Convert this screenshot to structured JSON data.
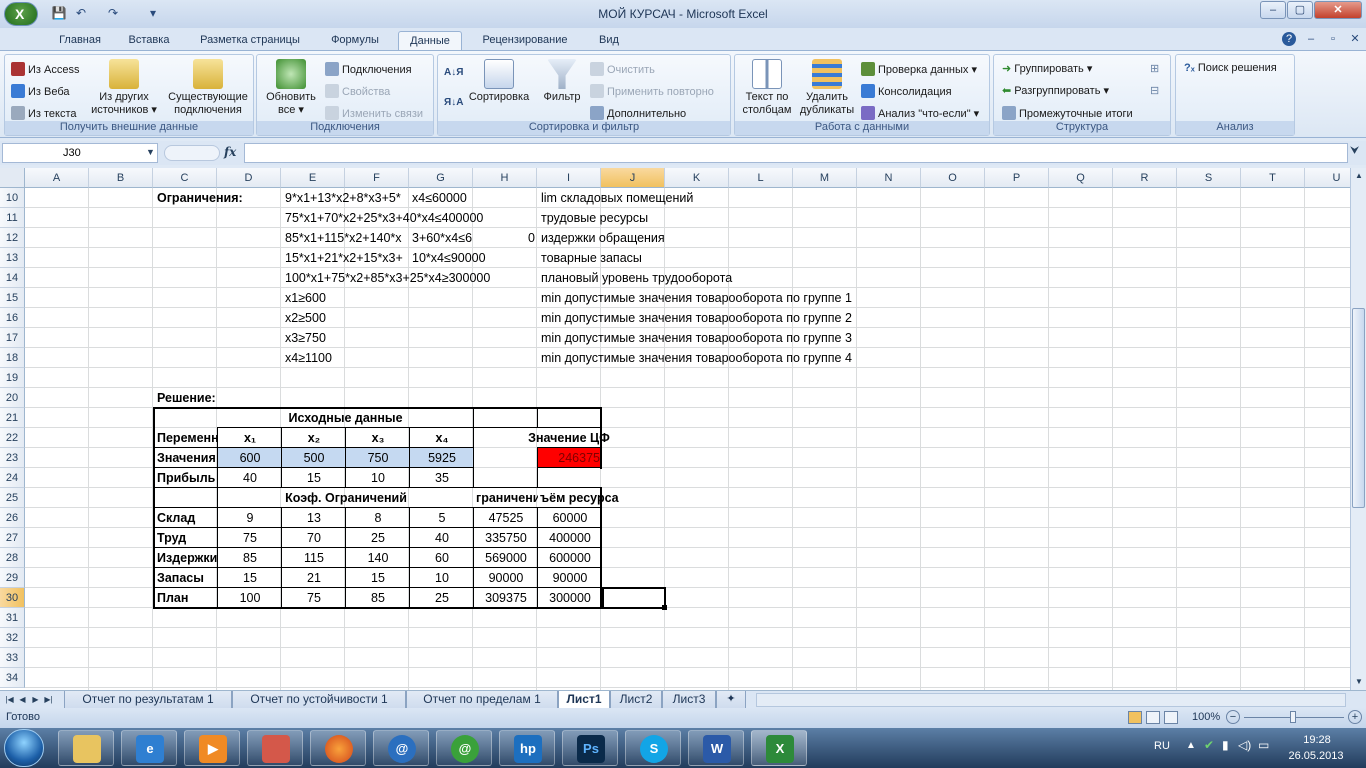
{
  "window": {
    "title": "МОЙ КУРСАЧ - Microsoft Excel",
    "min": "–",
    "max": "▢",
    "close": "✕"
  },
  "tabs": [
    "Главная",
    "Вставка",
    "Разметка страницы",
    "Формулы",
    "Данные",
    "Рецензирование",
    "Вид"
  ],
  "active_tab": "Данные",
  "ribbon": {
    "external": {
      "label": "Получить внешние данные",
      "access": "Из Access",
      "web": "Из Веба",
      "text": "Из текста",
      "other": [
        "Из других",
        "источников ▾"
      ],
      "existing": [
        "Существующие",
        "подключения"
      ]
    },
    "connections": {
      "label": "Подключения",
      "refresh": [
        "Обновить",
        "все ▾"
      ],
      "connections": "Подключения",
      "properties": "Свойства",
      "edit_links": "Изменить связи"
    },
    "sort_filter": {
      "label": "Сортировка и фильтр",
      "sort": "Сортировка",
      "filter": "Фильтр",
      "clear": "Очистить",
      "reapply": "Применить повторно",
      "advanced": "Дополнительно"
    },
    "data_tools": {
      "label": "Работа с данными",
      "text_to_columns": [
        "Текст по",
        "столбцам"
      ],
      "remove_duplicates": [
        "Удалить",
        "дубликаты"
      ],
      "validation": "Проверка данных ▾",
      "consolidate": "Консолидация",
      "whatif": "Анализ \"что-если\" ▾"
    },
    "outline": {
      "label": "Структура",
      "group": "Группировать ▾",
      "ungroup": "Разгруппировать ▾",
      "subtotal": "Промежуточные итоги"
    },
    "analysis": {
      "label": "Анализ",
      "solver": "Поиск решения"
    }
  },
  "namebox": "J30",
  "fx": "fx",
  "columns": [
    "A",
    "B",
    "C",
    "D",
    "E",
    "F",
    "G",
    "H",
    "I",
    "J",
    "K",
    "L",
    "M",
    "N",
    "O",
    "P",
    "Q",
    "R",
    "S",
    "T",
    "U"
  ],
  "selected_column": "J",
  "rows": [
    "10",
    "11",
    "12",
    "13",
    "14",
    "15",
    "16",
    "17",
    "18",
    "19",
    "20",
    "21",
    "22",
    "23",
    "24",
    "25",
    "26",
    "27",
    "28",
    "29",
    "30",
    "31",
    "32",
    "33",
    "34"
  ],
  "selected_row": "30",
  "cells": {
    "c10": "Ограничения:",
    "e10": "9*x1+13*x2+8*x3+5*",
    "g10": "x4≤60000",
    "i10": "lim складовых помещений",
    "e11": "75*x1+70*x2+25*x3+40*x4≤400000",
    "i11": "трудовые ресурсы",
    "e12": "85*x1+115*x2+140*x",
    "g12": "3+60*x4≤6",
    "h12": "0",
    "i12": "издержки обращения",
    "e13": "15*x1+21*x2+15*x3+",
    "g13": "10*x4≤90000",
    "i13": "товарные запасы",
    "e14": "100*x1+75*x2+85*x3+25*x4≥300000",
    "i14": "плановый уровень трудооборота",
    "e15": "x1≥600",
    "i15": "min допустимые значения товарооборота по группе 1",
    "e16": "x2≥500",
    "i16": "min допустимые значения товарооборота по группе 2",
    "e17": "x3≥750",
    "i17": "min допустимые значения товарооборота по группе 3",
    "e18": "x4≥1100",
    "i18": "min допустимые значения товарооборота по группе 4",
    "c20": "Решение:",
    "e21": "Исходные данные",
    "c22": "Переменные",
    "d22": "x₁",
    "e22": "x₂",
    "f22": "x₃",
    "g22": "x₄",
    "h22": "Значение ЦФ",
    "c23": "Значения",
    "d23": "600",
    "e23": "500",
    "f23": "750",
    "g23": "5925",
    "i23": "246375",
    "c24": "Прибыль",
    "d24": "40",
    "e24": "15",
    "f24": "10",
    "g24": "35",
    "d25": "Коэф. Ограничений",
    "h25": "граничени",
    "i25": "ъём ресурса",
    "c26": "Склад",
    "d26": "9",
    "e26": "13",
    "f26": "8",
    "g26": "5",
    "h26": "47525",
    "i26": "60000",
    "c27": "Труд",
    "d27": "75",
    "e27": "70",
    "f27": "25",
    "g27": "40",
    "h27": "335750",
    "i27": "400000",
    "c28": "Издержки",
    "d28": "85",
    "e28": "115",
    "f28": "140",
    "g28": "60",
    "h28": "569000",
    "i28": "600000",
    "c29": "Запасы",
    "d29": "15",
    "e29": "21",
    "f29": "15",
    "g29": "10",
    "h29": "90000",
    "i29": "90000",
    "c30": "План",
    "d30": "100",
    "e30": "75",
    "f30": "85",
    "g30": "25",
    "h30": "309375",
    "i30": "300000"
  },
  "sheets": [
    "Отчет по результатам 1",
    "Отчет по устойчивости 1",
    "Отчет по пределам 1",
    "Лист1",
    "Лист2",
    "Лист3"
  ],
  "active_sheet": "Лист1",
  "status": {
    "ready": "Готово",
    "zoom": "100%"
  },
  "taskbar": {
    "lang": "RU",
    "time": "19:28",
    "date": "26.05.2013"
  },
  "colors": {
    "highlight_red": "#ff0000",
    "value_blue": "#c5d9f1",
    "accent": "#2a5a9b"
  }
}
